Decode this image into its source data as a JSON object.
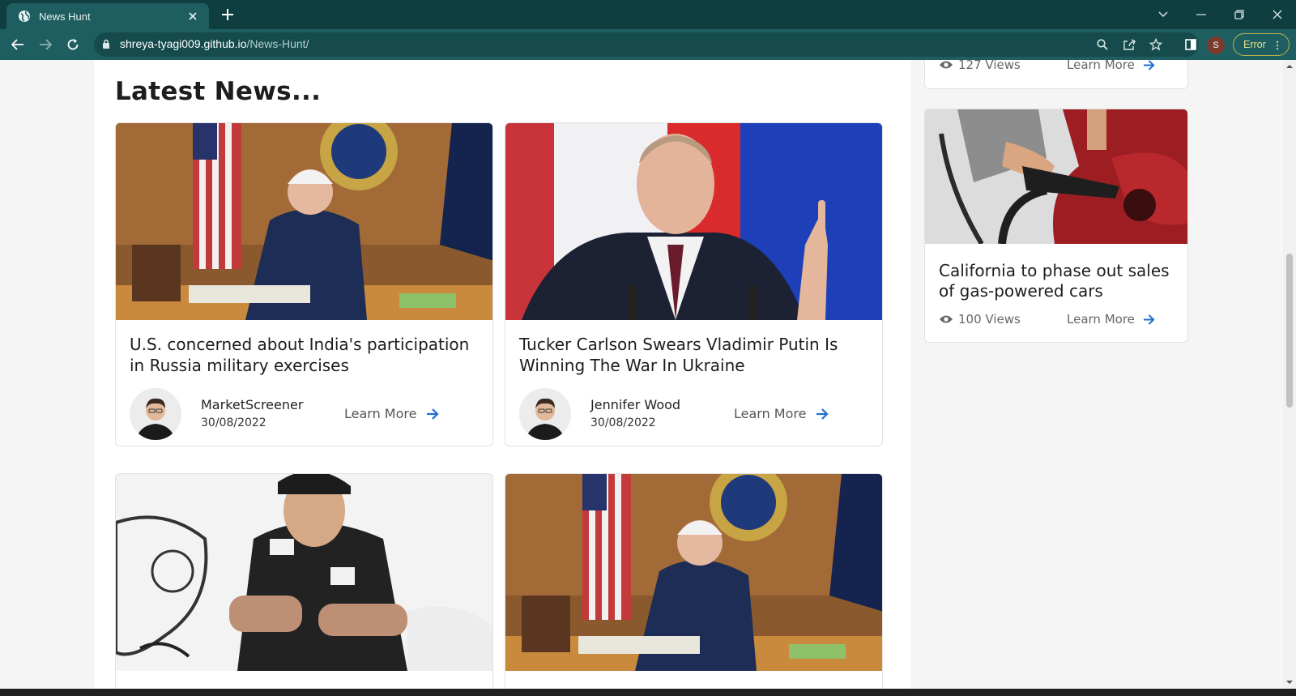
{
  "browser": {
    "tab_title": "News Hunt",
    "url_host": "shreya-tyagi009.github.io",
    "url_path": "/News-Hunt/",
    "profile_initial": "S",
    "error_label": "Error",
    "icons": [
      "globe-icon",
      "close-icon",
      "plus-icon",
      "chevron-down-icon",
      "minimize-icon",
      "restore-icon",
      "window-close-icon",
      "back-icon",
      "forward-icon",
      "reload-icon",
      "lock-icon",
      "search-icon",
      "share-icon",
      "star-icon",
      "sidepanel-icon",
      "kebab-icon"
    ]
  },
  "page": {
    "heading": "Latest News...",
    "cards": [
      {
        "title": "U.S. concerned about India's participation in Russia military exercises",
        "author": "MarketScreener",
        "date": "30/08/2022",
        "learn_more": "Learn More"
      },
      {
        "title": "Tucker Carlson Swears Vladimir Putin Is Winning The War In Ukraine",
        "author": "Jennifer Wood",
        "date": "30/08/2022",
        "learn_more": "Learn More"
      },
      {
        "title": "",
        "author": "",
        "date": "",
        "learn_more": ""
      },
      {
        "title": "",
        "author": "",
        "date": "",
        "learn_more": ""
      }
    ]
  },
  "sidebar": {
    "items": [
      {
        "title": "",
        "views": "127 Views",
        "learn_more": "Learn More"
      },
      {
        "title": "California to phase out sales of gas-powered cars",
        "views": "100 Views",
        "learn_more": "Learn More"
      }
    ]
  },
  "colors": {
    "tabbar": "#0f3e41",
    "toolbar": "#1f5e60",
    "accent_arrow": "#1f6fd1",
    "text_dark": "#1d1d1d"
  }
}
